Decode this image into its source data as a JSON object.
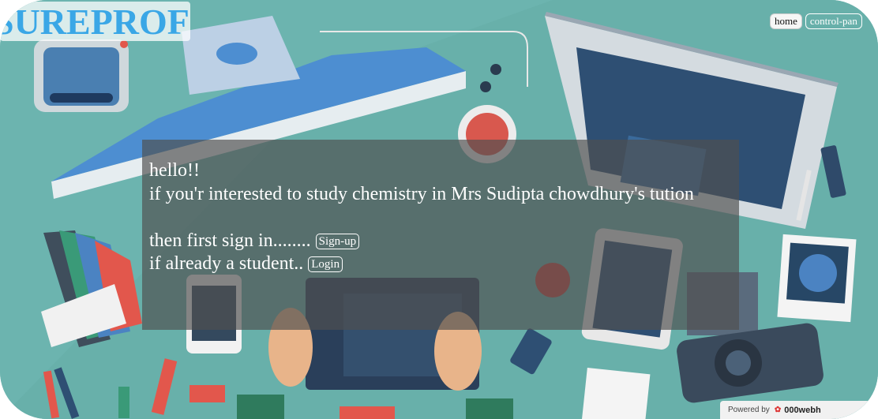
{
  "header": {
    "logo_text": "SUREPROF",
    "nav": [
      {
        "label": "home"
      },
      {
        "label": "control-pan"
      }
    ]
  },
  "panel": {
    "line1": "hello!!",
    "line2": "if you'r interested to study chemistry in Mrs Sudipta chowdhury's tution",
    "line3": "then first sign in........",
    "signup_label": "Sign-up",
    "line4": "if already a student..",
    "login_label": "Login"
  },
  "footer": {
    "powered_prefix": "Powered by",
    "powered_brand": "000webh"
  },
  "colors": {
    "background": "#6fb6b1",
    "logo_text": "#3aa7e6",
    "panel": "rgba(80,80,80,0.68)"
  }
}
